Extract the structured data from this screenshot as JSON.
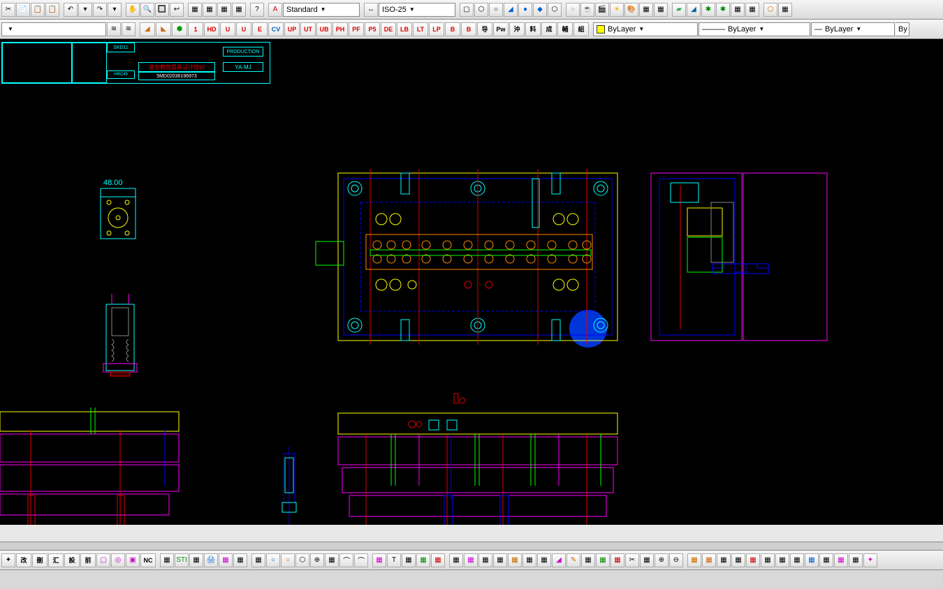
{
  "toolbar1": {
    "textStyle": "Standard",
    "dimStyle": "ISO-25"
  },
  "toolbar2": {
    "redLabels": [
      "1",
      "HD",
      "U",
      "U",
      "E",
      "CV",
      "UP",
      "UT",
      "UB",
      "PH",
      "PF",
      "P5",
      "DE",
      "LB",
      "LT",
      "LP",
      "B",
      "B"
    ],
    "cjkLabels": [
      "导",
      "Pw",
      "沖",
      "料",
      "成",
      "輔",
      "組"
    ],
    "layer": "ByLayer",
    "linetype": "ByLayer",
    "lineweight": "ByLayer",
    "plot": "By"
  },
  "titleBlock": {
    "mat": "SKD11",
    "title": "激安教育提具设计培训",
    "status": "PRODUCTION",
    "code": "YA-MJ",
    "hrc": "HRC45",
    "partno": "5MD02036196973"
  },
  "drawing": {
    "dim1": "48.00"
  },
  "toolbar3": {
    "cjk": [
      "改",
      "刪",
      "汇",
      "設",
      "前"
    ],
    "nc": "NC"
  }
}
